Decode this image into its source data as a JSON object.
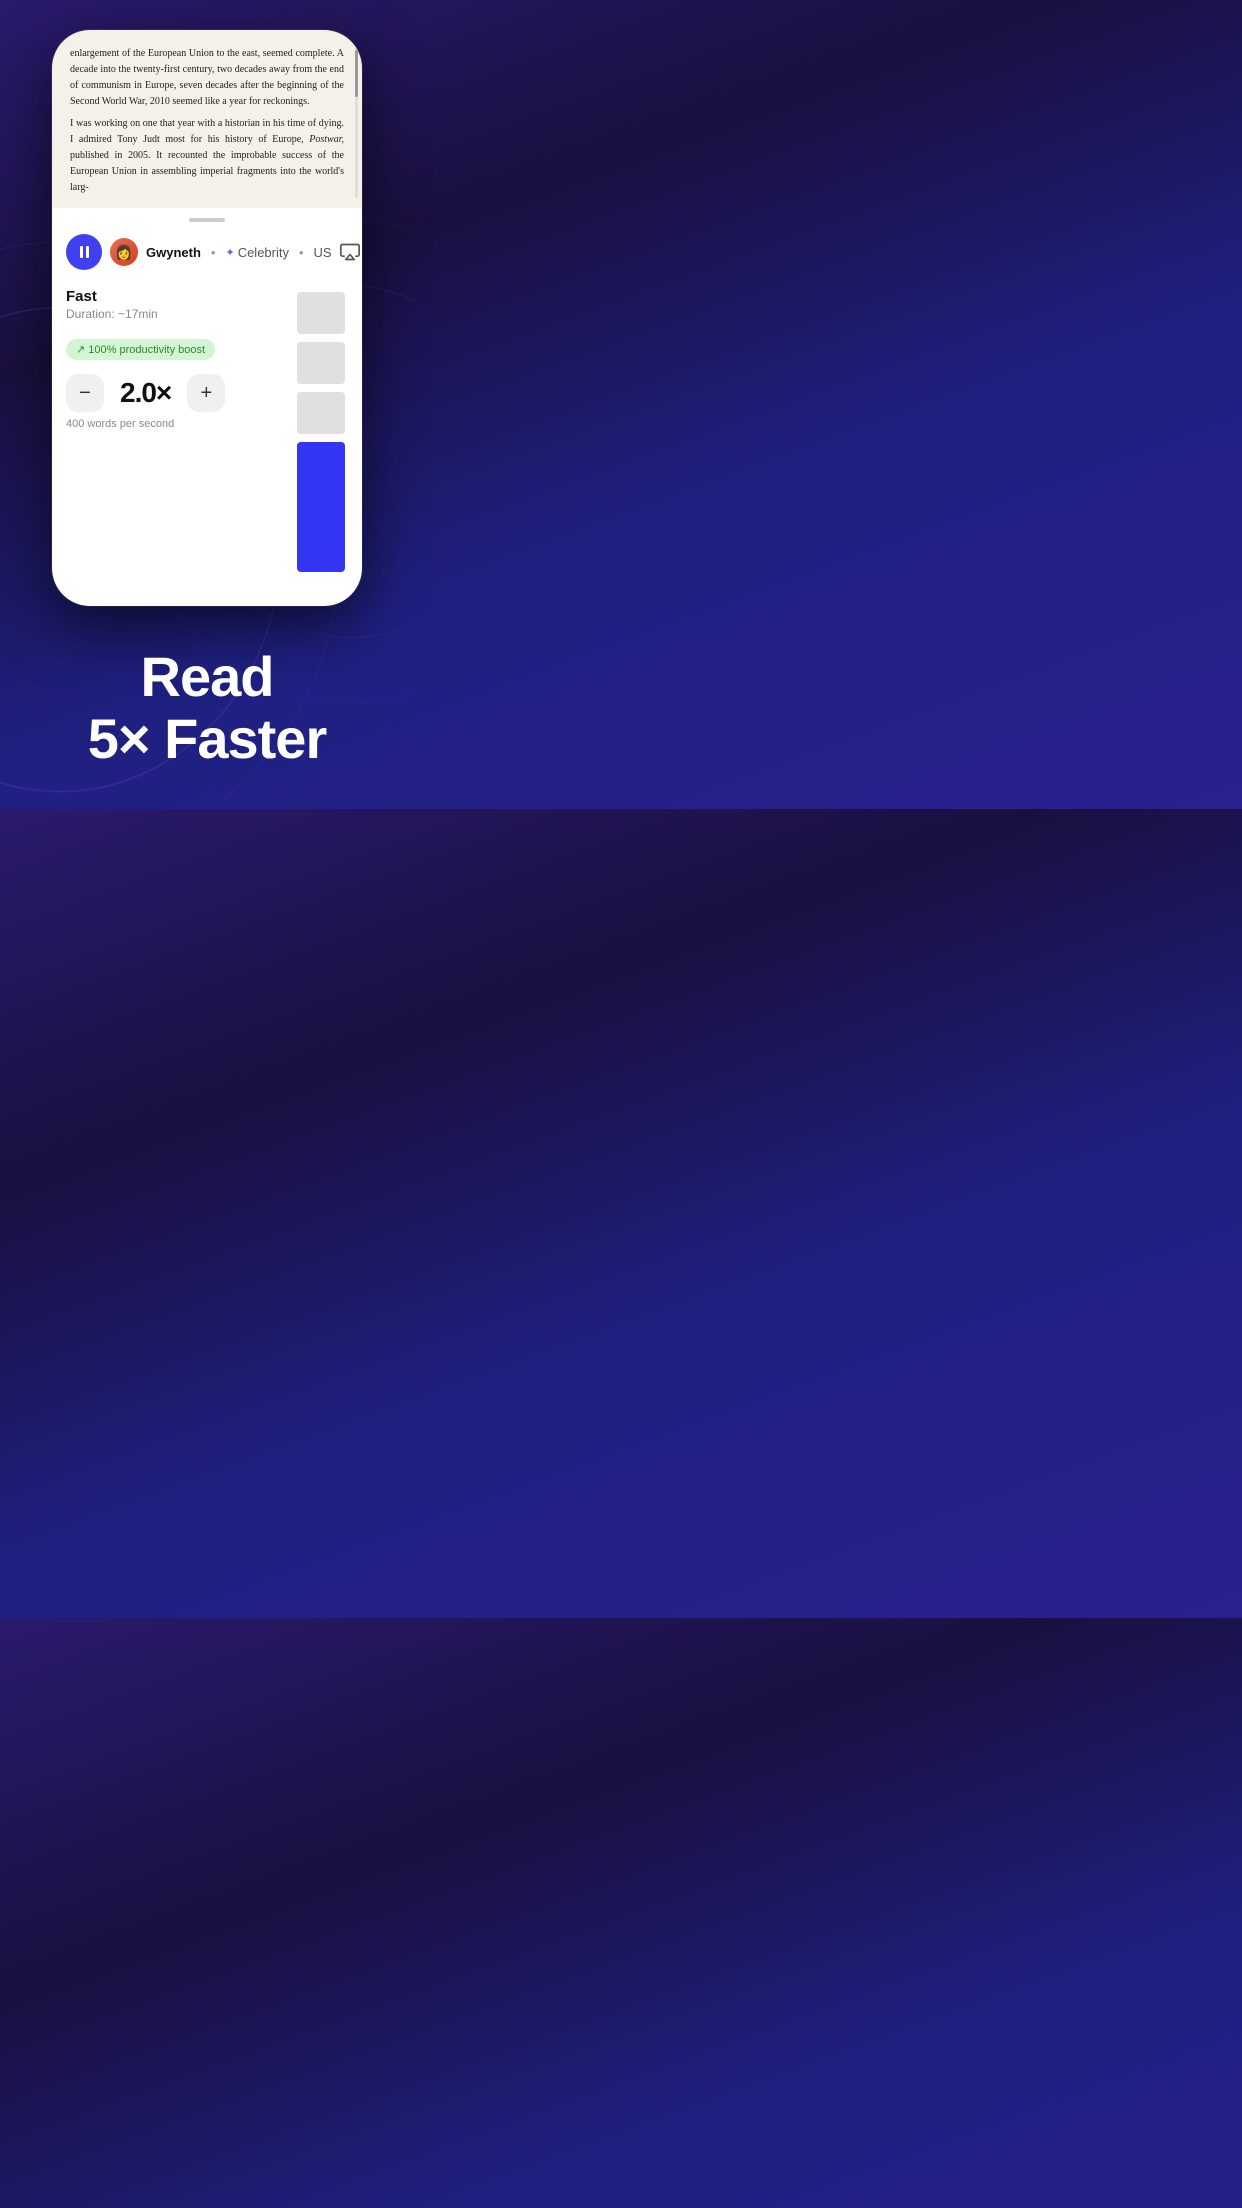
{
  "background": {
    "color_start": "#2a1a6e",
    "color_end": "#1e2080"
  },
  "book_text": {
    "paragraph1": "enlargement of the European Union to the east, seemed complete. A decade into the twenty-first century, two decades away from the end of communism in Europe, seven decades after the beginning of the Second World War, 2010 seemed like a year for reckonings.",
    "paragraph2": "I was working on one that year with a historian in his time of dying. I admired Tony Judt most for his history of Europe, ",
    "postwar_italic": "Postwar,",
    "paragraph3": " published in 2005. It recounted the improbable success of the European Union in assembling imperial fragments into the world's larg-"
  },
  "drag_handle": {
    "visible": true
  },
  "voice_bar": {
    "pause_button_label": "pause",
    "avatar_emoji": "👩",
    "voice_name": "Gwyneth",
    "separator": "•",
    "category_icon": "✦",
    "category": "Celebrity",
    "region": "US",
    "airplay_icon": "airplay"
  },
  "speed_section": {
    "title": "Fast",
    "duration_label": "Duration: ~17min",
    "productivity_badge": "↗ 100% productivity boost",
    "minus_label": "−",
    "plus_label": "+",
    "speed_value": "2.0×",
    "words_per_second": "400 words per second",
    "slider": {
      "total_segments": 6,
      "active_from": 3,
      "active_color": "#3535f5",
      "inactive_color": "#e0e0e0"
    }
  },
  "marketing": {
    "line1": "Read",
    "line2": "5× Faster"
  }
}
